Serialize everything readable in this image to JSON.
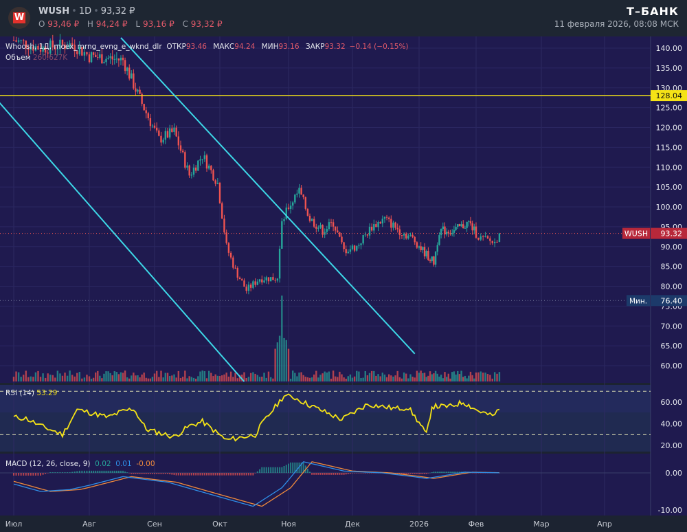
{
  "header": {
    "ticker": "WUSH",
    "interval": "1D",
    "price": "93,32 ₽",
    "o_label": "O",
    "o": "93,46 ₽",
    "h_label": "H",
    "h": "94,24 ₽",
    "l_label": "L",
    "l": "93,16 ₽",
    "c_label": "C",
    "c": "93,32 ₽",
    "brand": "Т–БАНК",
    "datetime": "11 февраля 2026, 08:08 МСК",
    "logo_letter": "W"
  },
  "legend": {
    "title": "Whoosh, 1Д, moex_mrng_evng_e_wknd_dlr",
    "open_label": "ОТКР",
    "open": "93.46",
    "high_label": "МАКС",
    "high": "94.24",
    "low_label": "МИН",
    "low": "93.16",
    "close_label": "ЗАКР",
    "close": "93.32",
    "change": "−0.14 (−0.15%)",
    "volume_label": "Объем",
    "volume": "260.627K"
  },
  "rsi_legend": {
    "label": "RSI (14)",
    "value": "53.29"
  },
  "macd_legend": {
    "label": "MACD (12, 26, close, 9)",
    "macd": "0.02",
    "signal": "0.01",
    "hist": "-0.00"
  },
  "badges": {
    "last_name": "WUSH",
    "last_value": "93.32",
    "hline_value": "128.04",
    "min_label": "Мин.",
    "min_value": "76.40"
  },
  "colors": {
    "up": "#26a69a",
    "down": "#ef5350",
    "trendline": "#3dd9e8",
    "hline": "#f5e316",
    "rsi": "#f5e316",
    "macd": "#2f8fe8",
    "signal": "#f08a3c",
    "background": "#1f1a4f"
  },
  "chart_data": [
    {
      "type": "candlestick",
      "ylim": [
        55,
        142
      ],
      "yticks": [
        60,
        65,
        70,
        75,
        80,
        85,
        90,
        95,
        100,
        105,
        110,
        115,
        120,
        125,
        130,
        135,
        140
      ],
      "xticks": [
        {
          "date": "2025-07-01",
          "label": "Июл"
        },
        {
          "date": "2025-08-01",
          "label": "Авг"
        },
        {
          "date": "2025-09-01",
          "label": "Сен"
        },
        {
          "date": "2025-10-01",
          "label": "Окт"
        },
        {
          "date": "2025-11-01",
          "label": "Ноя"
        },
        {
          "date": "2025-12-01",
          "label": "Дек"
        },
        {
          "date": "2026-01-01",
          "label": "2026"
        },
        {
          "date": "2026-02-01",
          "label": "Фев"
        },
        {
          "date": "2026-03-01",
          "label": "Мар"
        },
        {
          "date": "2026-04-01",
          "label": "Апр"
        }
      ],
      "close_keypoints": [
        [
          "2025-07-01",
          142
        ],
        [
          "2025-07-12",
          140
        ],
        [
          "2025-07-25",
          141
        ],
        [
          "2025-08-01",
          138
        ],
        [
          "2025-08-17",
          137
        ],
        [
          "2025-08-26",
          126
        ],
        [
          "2025-09-03",
          117
        ],
        [
          "2025-09-10",
          119
        ],
        [
          "2025-09-17",
          108
        ],
        [
          "2025-09-23",
          113
        ],
        [
          "2025-09-30",
          106
        ],
        [
          "2025-10-04",
          90
        ],
        [
          "2025-10-08",
          84
        ],
        [
          "2025-10-13",
          79
        ],
        [
          "2025-10-19",
          82
        ],
        [
          "2025-10-27",
          82
        ],
        [
          "2025-10-29",
          96
        ],
        [
          "2025-11-01",
          100
        ],
        [
          "2025-11-06",
          104
        ],
        [
          "2025-11-11",
          97
        ],
        [
          "2025-11-17",
          94
        ],
        [
          "2025-11-22",
          96
        ],
        [
          "2025-11-27",
          89
        ],
        [
          "2025-12-03",
          90
        ],
        [
          "2025-12-10",
          95
        ],
        [
          "2025-12-16",
          97
        ],
        [
          "2025-12-23",
          94
        ],
        [
          "2025-12-29",
          92
        ],
        [
          "2026-01-03",
          89
        ],
        [
          "2026-01-09",
          86
        ],
        [
          "2026-01-12",
          94
        ],
        [
          "2026-01-20",
          94
        ],
        [
          "2026-01-28",
          96
        ],
        [
          "2026-02-03",
          92
        ],
        [
          "2026-02-09",
          91
        ],
        [
          "2026-02-11",
          93.32
        ]
      ],
      "horizontal_line": 128.04,
      "last_price": 93.32,
      "min_price": 76.4,
      "trendlines": [
        {
          "from": [
            "2025-06-25",
            126.5
          ],
          "to": [
            "2025-10-12",
            56
          ]
        },
        {
          "from": [
            "2025-08-16",
            142.6
          ],
          "to": [
            "2025-12-30",
            63
          ]
        }
      ]
    },
    {
      "type": "line",
      "name": "RSI (14)",
      "ylim": [
        10,
        72
      ],
      "yticks": [
        20,
        40,
        60
      ],
      "bands": [
        30,
        70
      ],
      "keypoints": [
        [
          "2025-07-01",
          46
        ],
        [
          "2025-07-06",
          45
        ],
        [
          "2025-07-12",
          38
        ],
        [
          "2025-07-18",
          33
        ],
        [
          "2025-07-21",
          30
        ],
        [
          "2025-07-27",
          53
        ],
        [
          "2025-08-10",
          46
        ],
        [
          "2025-08-16",
          51
        ],
        [
          "2025-08-22",
          54
        ],
        [
          "2025-08-28",
          35
        ],
        [
          "2025-09-10",
          28
        ],
        [
          "2025-09-17",
          38
        ],
        [
          "2025-09-23",
          42
        ],
        [
          "2025-10-04",
          25
        ],
        [
          "2025-10-17",
          30
        ],
        [
          "2025-10-20",
          40
        ],
        [
          "2025-10-30",
          66
        ],
        [
          "2025-11-04",
          64
        ],
        [
          "2025-11-10",
          58
        ],
        [
          "2025-11-26",
          44
        ],
        [
          "2025-12-08",
          58
        ],
        [
          "2025-12-21",
          54
        ],
        [
          "2025-12-27",
          55
        ],
        [
          "2026-01-05",
          30
        ],
        [
          "2026-01-08",
          56
        ],
        [
          "2026-01-18",
          56
        ],
        [
          "2026-01-25",
          60
        ],
        [
          "2026-02-02",
          52
        ],
        [
          "2026-02-08",
          47
        ],
        [
          "2026-02-11",
          53.29
        ]
      ]
    },
    {
      "type": "line",
      "name": "MACD (12, 26, close, 9)",
      "ylim": [
        -11,
        4
      ],
      "yticks": [
        0,
        -10
      ],
      "macd_keypoints": [
        [
          "2025-07-01",
          -3
        ],
        [
          "2025-07-12",
          -5
        ],
        [
          "2025-07-24",
          -4.5
        ],
        [
          "2025-08-17",
          -1
        ],
        [
          "2025-09-07",
          -2.5
        ],
        [
          "2025-10-04",
          -7
        ],
        [
          "2025-10-16",
          -9
        ],
        [
          "2025-10-29",
          -4
        ],
        [
          "2025-11-08",
          3
        ],
        [
          "2025-11-27",
          0.5
        ],
        [
          "2025-12-15",
          0
        ],
        [
          "2026-01-05",
          -1.5
        ],
        [
          "2026-01-26",
          0.2
        ],
        [
          "2026-02-11",
          0.02
        ]
      ]
    }
  ]
}
